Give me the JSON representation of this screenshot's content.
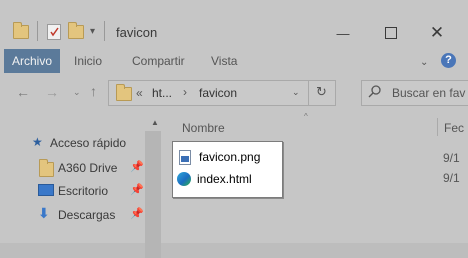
{
  "window": {
    "title": "favicon"
  },
  "ribbon": {
    "tabs": [
      "Archivo",
      "Inicio",
      "Compartir",
      "Vista"
    ]
  },
  "address": {
    "ellipsis": "«",
    "segments": [
      "ht...",
      "favicon"
    ],
    "separator": "›"
  },
  "search": {
    "placeholder": "Buscar en fav"
  },
  "sidebar": {
    "quick_access": "Acceso rápido",
    "items": [
      {
        "label": "A360 Drive"
      },
      {
        "label": "Escritorio"
      },
      {
        "label": "Descargas"
      }
    ]
  },
  "columns": {
    "name": "Nombre",
    "date": "Fec"
  },
  "files": [
    {
      "name": "favicon.png",
      "date": "9/1"
    },
    {
      "name": "index.html",
      "date": "9/1"
    }
  ],
  "colors": {
    "tab_active": "#5b7a9a",
    "help": "#4a76b8",
    "folder": "#e3c57e"
  }
}
